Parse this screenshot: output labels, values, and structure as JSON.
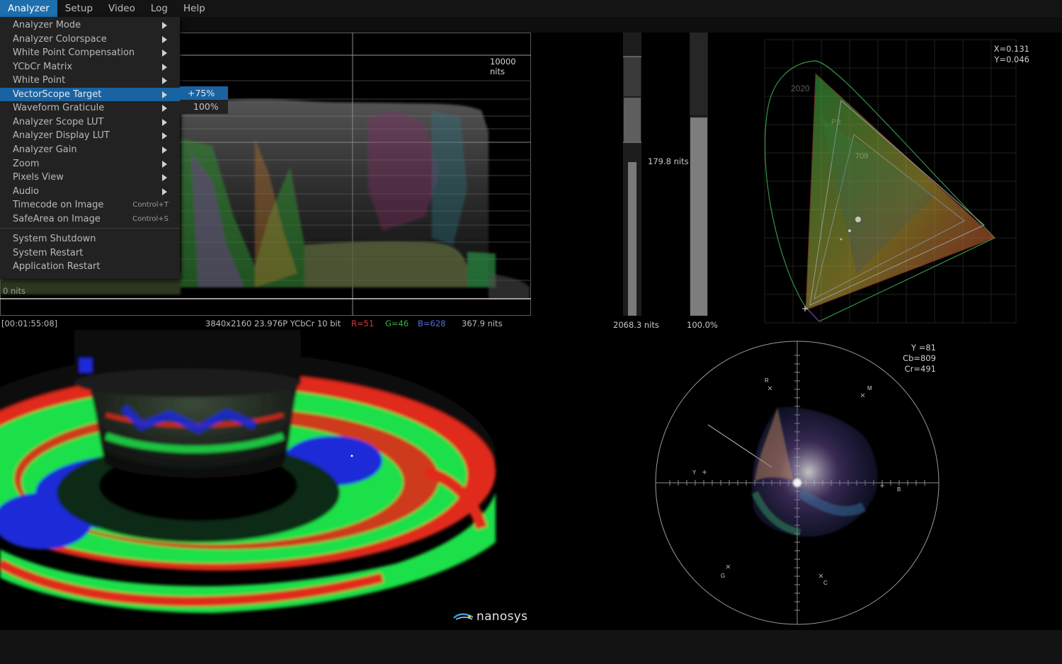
{
  "menubar": {
    "items": [
      {
        "label": "Analyzer",
        "active": true
      },
      {
        "label": "Setup"
      },
      {
        "label": "Video"
      },
      {
        "label": "Log"
      },
      {
        "label": "Help"
      }
    ]
  },
  "analyzer_menu": {
    "items": [
      {
        "label": "Analyzer Mode",
        "submenu": true
      },
      {
        "label": "Analyzer Colorspace",
        "submenu": true
      },
      {
        "label": "White Point Compensation",
        "submenu": true
      },
      {
        "label": "YCbCr Matrix",
        "submenu": true
      },
      {
        "label": "White Point",
        "submenu": true
      },
      {
        "label": "VectorScope Target",
        "submenu": true,
        "highlighted": true
      },
      {
        "label": "Waveform Graticule",
        "submenu": true
      },
      {
        "label": "Analyzer Scope LUT",
        "submenu": true
      },
      {
        "label": "Analyzer Display LUT",
        "submenu": true
      },
      {
        "label": "Analyzer Gain",
        "submenu": true
      },
      {
        "label": "Zoom",
        "submenu": true
      },
      {
        "label": "Pixels View",
        "submenu": true
      },
      {
        "label": "Audio",
        "submenu": true
      },
      {
        "label": "Timecode on Image",
        "shortcut": "Control+T"
      },
      {
        "label": "SafeArea on Image",
        "shortcut": "Control+S"
      }
    ],
    "system_items": [
      {
        "label": "System Shutdown"
      },
      {
        "label": "System Restart"
      },
      {
        "label": "Application Restart"
      }
    ]
  },
  "vectorscope_target_submenu": {
    "items": [
      {
        "label": "+75%",
        "selected": true
      },
      {
        "label": "100%"
      }
    ]
  },
  "waveform": {
    "top_label": "10000 nits",
    "bottom_label": "0 nits"
  },
  "info_bar": {
    "timecode": "[00:01:55:08]",
    "format": "3840x2160 23.976P YCbCr 10 bit",
    "r": "R=51",
    "g": "G=46",
    "b": "B=628",
    "nits": "367.9 nits",
    "colors": {
      "r": "#d23a3a",
      "g": "#3fae3f",
      "b": "#4f6fe0"
    }
  },
  "meters": {
    "nits_meter": {
      "mid_label": "179.8 nits",
      "bottom_label": "2068.3 nits",
      "level": 0.56
    },
    "percent_meter": {
      "bottom_label": "100.0%",
      "level": 0.7
    }
  },
  "cie": {
    "readout_x": "X=0.131",
    "readout_y": "Y=0.046",
    "gamuts": [
      "2020",
      "P3",
      "709"
    ]
  },
  "vectorscope": {
    "readout_y": "Y =81",
    "readout_cb": "Cb=809",
    "readout_cr": "Cr=491",
    "targets": [
      "R",
      "M",
      "B",
      "C",
      "G",
      "Y"
    ]
  },
  "logo": {
    "text": "nanosys"
  }
}
